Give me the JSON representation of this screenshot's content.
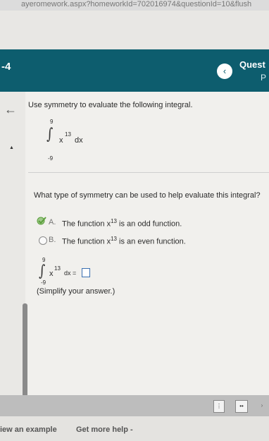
{
  "browser": {
    "url": "ayeromework.aspx?homeworkId=702016974&questionId=10&flush"
  },
  "header": {
    "number": "-4",
    "title": "Quest",
    "subtitle": "P"
  },
  "question": {
    "prompt": "Use symmetry to evaluate the following integral.",
    "integral": {
      "upper": "9",
      "lower": "-9",
      "base": "x",
      "exp": "13",
      "dx": "dx"
    },
    "sub_prompt": "What type of symmetry can be used to help evaluate this integral?",
    "options": [
      {
        "letter": "A.",
        "text_before": "The function x",
        "exp": "13",
        "text_after": " is an odd function.",
        "selected": true
      },
      {
        "letter": "B.",
        "text_before": "The function x",
        "exp": "13",
        "text_after": " is an even function.",
        "selected": false
      }
    ],
    "answer": {
      "upper": "9",
      "lower": "-9",
      "base": "x",
      "exp": "13",
      "dx": "dx ="
    },
    "simplify_note": "(Simplify your answer.)"
  },
  "footer": {
    "view_example": "iew an example",
    "more_help": "Get more help -"
  },
  "colors": {
    "header": "#0d5d6e",
    "correct_check": "#5a9e3a"
  }
}
